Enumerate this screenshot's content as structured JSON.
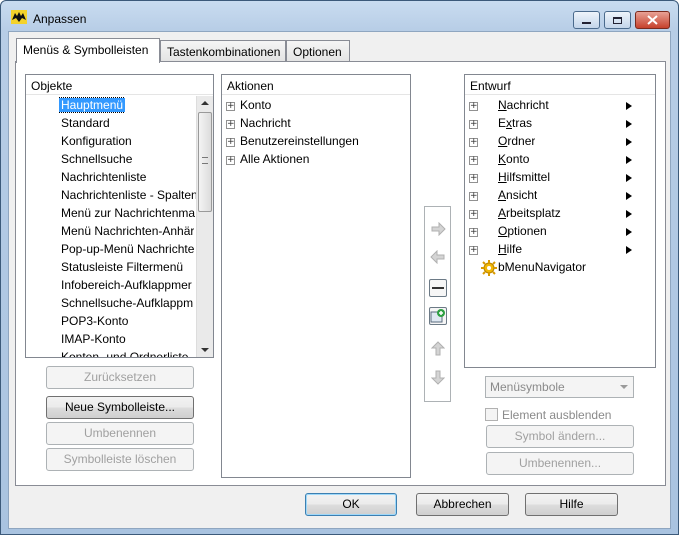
{
  "window": {
    "title": "Anpassen"
  },
  "tabs": [
    {
      "label": "Menüs & Symbolleisten",
      "active": true
    },
    {
      "label": "Tastenkombinationen",
      "active": false
    },
    {
      "label": "Optionen",
      "active": false
    }
  ],
  "objects": {
    "header": "Objekte",
    "items": [
      "Hauptmenü",
      "Standard",
      "Konfiguration",
      "Schnellsuche",
      "Nachrichtenliste",
      "Nachrichtenliste - Spalten",
      "Menü zur Nachrichtenma",
      "Menü Nachrichten-Anhär",
      "Pop-up-Menü Nachrichte",
      "Statusleiste Filtermenü",
      "Infobereich-Aufklappmer",
      "Schnellsuche-Aufklappm",
      "POP3-Konto",
      "IMAP-Konto",
      "Konten- und Ordnerliste"
    ],
    "selected": "Hauptmenü"
  },
  "actions": {
    "header": "Aktionen",
    "items": [
      "Konto",
      "Nachricht",
      "Benutzereinstellungen",
      "Alle Aktionen"
    ]
  },
  "design": {
    "header": "Entwurf",
    "items": [
      {
        "label": "Nachricht",
        "u": "N",
        "rest": "achricht"
      },
      {
        "label": "Extras",
        "u": "E",
        "rest": "xtras"
      },
      {
        "label": "Ordner",
        "u": "O",
        "rest": "rdner"
      },
      {
        "label": "Konto",
        "u": "K",
        "rest": "onto"
      },
      {
        "label": "Hilfsmittel",
        "u": "H",
        "rest": "ilfsmittel"
      },
      {
        "label": "Ansicht",
        "u": "A",
        "rest": "nsicht"
      },
      {
        "label": "Arbeitsplatz",
        "u": "A",
        "rest": "rbeitsplatz"
      },
      {
        "label": "Optionen",
        "u": "O",
        "rest": "ptionen"
      },
      {
        "label": "Hilfe",
        "u": "H",
        "rest": "ilfe"
      }
    ],
    "special_item": "bMenuNavigator"
  },
  "left_buttons": {
    "reset": "Zurücksetzen",
    "new_toolbar": "Neue Symbolleiste...",
    "rename": "Umbenennen",
    "delete_toolbar": "Symbolleiste löschen"
  },
  "right_controls": {
    "menu_symbols": "Menüsymbole",
    "hide_element": "Element ausblenden",
    "change_symbol": "Symbol ändern...",
    "rename": "Umbenennen..."
  },
  "footer": {
    "ok": "OK",
    "cancel": "Abbrechen",
    "help": "Hilfe"
  },
  "colors": {
    "selection": "#3399ff",
    "accent_green": "#2ea043"
  }
}
